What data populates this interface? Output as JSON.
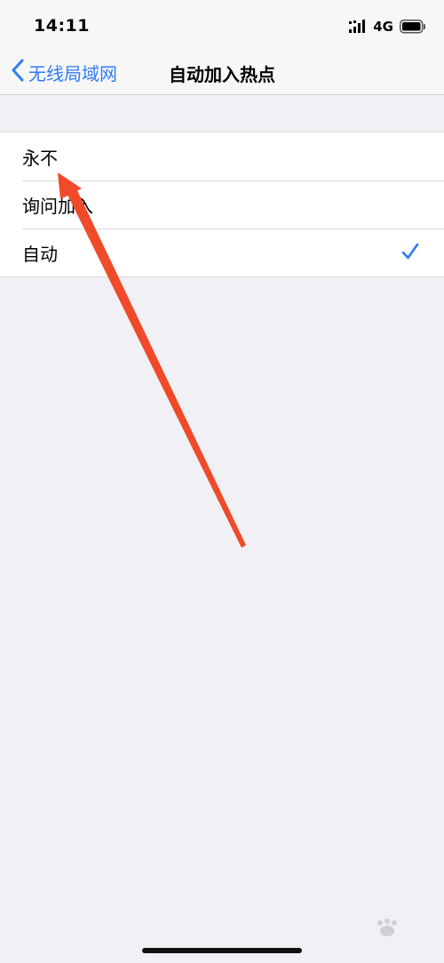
{
  "status_bar": {
    "time": "14:11",
    "network": "4G",
    "icons": [
      "signal-icon",
      "battery-icon"
    ]
  },
  "nav": {
    "back_label": "无线局域网",
    "title": "自动加入热点"
  },
  "options": [
    {
      "label": "永不",
      "selected": false
    },
    {
      "label": "询问加入",
      "selected": false
    },
    {
      "label": "自动",
      "selected": true
    }
  ],
  "colors": {
    "accent": "#2f7cf6",
    "background": "#f1f0f5",
    "annotation": "#f04a2a"
  }
}
